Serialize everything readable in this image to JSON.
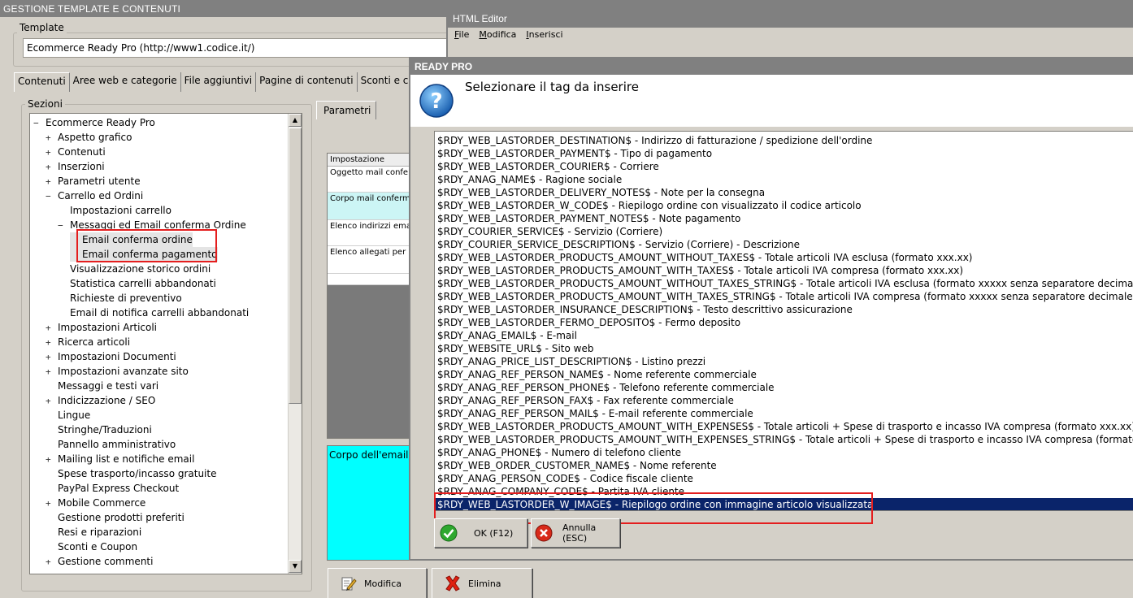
{
  "main_window": {
    "title": "GESTIONE TEMPLATE E CONTENUTI",
    "template_label": "Template",
    "template_value": "Ecommerce Ready Pro (http://www1.codice.it/)",
    "tabs": [
      "Contenuti",
      "Aree web e categorie",
      "File aggiuntivi",
      "Pagine di contenuti",
      "Sconti e c"
    ],
    "sections_label": "Sezioni",
    "tree": [
      {
        "label": "Ecommerce Ready Pro",
        "toggle": "−",
        "level": 0
      },
      {
        "label": "Aspetto grafico",
        "toggle": "+",
        "level": 1
      },
      {
        "label": "Contenuti",
        "toggle": "+",
        "level": 1
      },
      {
        "label": "Inserzioni",
        "toggle": "+",
        "level": 1
      },
      {
        "label": "Parametri utente",
        "toggle": "+",
        "level": 1
      },
      {
        "label": "Carrello ed Ordini",
        "toggle": "−",
        "level": 1
      },
      {
        "label": "Impostazioni carrello",
        "toggle": "",
        "level": 2
      },
      {
        "label": "Messaggi ed Email conferma Ordine",
        "toggle": "−",
        "level": 2
      },
      {
        "label": "Email conferma ordine",
        "toggle": "",
        "level": 3
      },
      {
        "label": "Email conferma pagamento",
        "toggle": "",
        "level": 3
      },
      {
        "label": "Visualizzazione storico ordini",
        "toggle": "",
        "level": 2
      },
      {
        "label": "Statistica carrelli abbandonati",
        "toggle": "",
        "level": 2
      },
      {
        "label": "Richieste di preventivo",
        "toggle": "",
        "level": 2
      },
      {
        "label": "Email di notifica carrelli abbandonati",
        "toggle": "",
        "level": 2
      },
      {
        "label": "Impostazioni Articoli",
        "toggle": "+",
        "level": 1
      },
      {
        "label": "Ricerca articoli",
        "toggle": "+",
        "level": 1
      },
      {
        "label": "Impostazioni Documenti",
        "toggle": "+",
        "level": 1
      },
      {
        "label": "Impostazioni avanzate sito",
        "toggle": "+",
        "level": 1
      },
      {
        "label": "Messaggi e testi vari",
        "toggle": "",
        "level": 1
      },
      {
        "label": "Indicizzazione / SEO",
        "toggle": "+",
        "level": 1
      },
      {
        "label": "Lingue",
        "toggle": "",
        "level": 1
      },
      {
        "label": "Stringhe/Traduzioni",
        "toggle": "",
        "level": 1
      },
      {
        "label": "Pannello amministrativo",
        "toggle": "",
        "level": 1
      },
      {
        "label": "Mailing list e notifiche email",
        "toggle": "+",
        "level": 1
      },
      {
        "label": "Spese trasporto/incasso gratuite",
        "toggle": "",
        "level": 1
      },
      {
        "label": "PayPal Express Checkout",
        "toggle": "",
        "level": 1
      },
      {
        "label": "Mobile Commerce",
        "toggle": "+",
        "level": 1
      },
      {
        "label": "Gestione prodotti preferiti",
        "toggle": "",
        "level": 1
      },
      {
        "label": "Resi e riparazioni",
        "toggle": "",
        "level": 1
      },
      {
        "label": "Sconti e Coupon",
        "toggle": "",
        "level": 1
      },
      {
        "label": "Gestione commenti",
        "toggle": "+",
        "level": 1
      }
    ],
    "params_tab": "Parametri",
    "grid_header": "Impostazione",
    "grid_rows": [
      "Oggetto mail conferma",
      "Corpo mail conferma",
      "Elenco indirizzi email",
      "Elenco allegati per m"
    ],
    "body_area_label": "Corpo dell'email c",
    "buttons": {
      "modify": "Modifica",
      "delete": "Elimina"
    }
  },
  "html_editor": {
    "title": "HTML Editor",
    "menu": [
      "File",
      "Modifica",
      "Inserisci"
    ]
  },
  "dialog": {
    "title": "READY PRO",
    "prompt": "Selezionare il tag da inserire",
    "items": [
      "$RDY_WEB_LASTORDER_DESTINATION$ - Indirizzo di fatturazione / spedizione dell'ordine",
      "$RDY_WEB_LASTORDER_PAYMENT$ - Tipo di pagamento",
      "$RDY_WEB_LASTORDER_COURIER$ - Corriere",
      "$RDY_ANAG_NAME$ - Ragione sociale",
      "$RDY_WEB_LASTORDER_DELIVERY_NOTES$ - Note per la consegna",
      "$RDY_WEB_LASTORDER_W_CODE$ - Riepilogo ordine con visualizzato il codice articolo",
      "$RDY_WEB_LASTORDER_PAYMENT_NOTES$ - Note pagamento",
      "$RDY_COURIER_SERVICE$ - Servizio (Corriere)",
      "$RDY_COURIER_SERVICE_DESCRIPTION$ - Servizio (Corriere) - Descrizione",
      "$RDY_WEB_LASTORDER_PRODUCTS_AMOUNT_WITHOUT_TAXES$ - Totale articoli IVA esclusa (formato xxx.xx)",
      "$RDY_WEB_LASTORDER_PRODUCTS_AMOUNT_WITH_TAXES$ - Totale articoli IVA compresa (formato xxx.xx)",
      "$RDY_WEB_LASTORDER_PRODUCTS_AMOUNT_WITHOUT_TAXES_STRING$ - Totale articoli IVA esclusa (formato xxxxx senza separatore decimale)",
      "$RDY_WEB_LASTORDER_PRODUCTS_AMOUNT_WITH_TAXES_STRING$ - Totale articoli IVA compresa (formato xxxxx senza separatore decimale)",
      "$RDY_WEB_LASTORDER_INSURANCE_DESCRIPTION$ - Testo descrittivo assicurazione",
      "$RDY_WEB_LASTORDER_FERMO_DEPOSITO$ - Fermo deposito",
      "$RDY_ANAG_EMAIL$ - E-mail",
      "$RDY_WEBSITE_URL$ - Sito web",
      "$RDY_ANAG_PRICE_LIST_DESCRIPTION$ - Listino prezzi",
      "$RDY_ANAG_REF_PERSON_NAME$ - Nome referente commerciale",
      "$RDY_ANAG_REF_PERSON_PHONE$ - Telefono referente commerciale",
      "$RDY_ANAG_REF_PERSON_FAX$ - Fax referente commerciale",
      "$RDY_ANAG_REF_PERSON_MAIL$ - E-mail referente commerciale",
      "$RDY_WEB_LASTORDER_PRODUCTS_AMOUNT_WITH_EXPENSES$ - Totale articoli + Spese di trasporto e incasso IVA compresa (formato xxx.xx)",
      "$RDY_WEB_LASTORDER_PRODUCTS_AMOUNT_WITH_EXPENSES_STRING$ - Totale articoli + Spese di trasporto e incasso IVA compresa (formato xx",
      "$RDY_ANAG_PHONE$ - Numero di telefono cliente",
      "$RDY_WEB_ORDER_CUSTOMER_NAME$ - Nome referente",
      "$RDY_ANAG_PERSON_CODE$ - Codice fiscale cliente",
      "$RDY_ANAG_COMPANY_CODE$ - Partita IVA cliente",
      "$RDY_WEB_LASTORDER_W_IMAGE$ - Riepilogo ordine con immagine articolo visualizzata"
    ],
    "selected_index": 28,
    "buttons": {
      "ok": "OK (F12)",
      "cancel": "Annulla (ESC)"
    }
  },
  "colors": {
    "selection": "#0a246a",
    "highlight_box": "#e41e1e",
    "cyan_panel": "#00ffff"
  }
}
